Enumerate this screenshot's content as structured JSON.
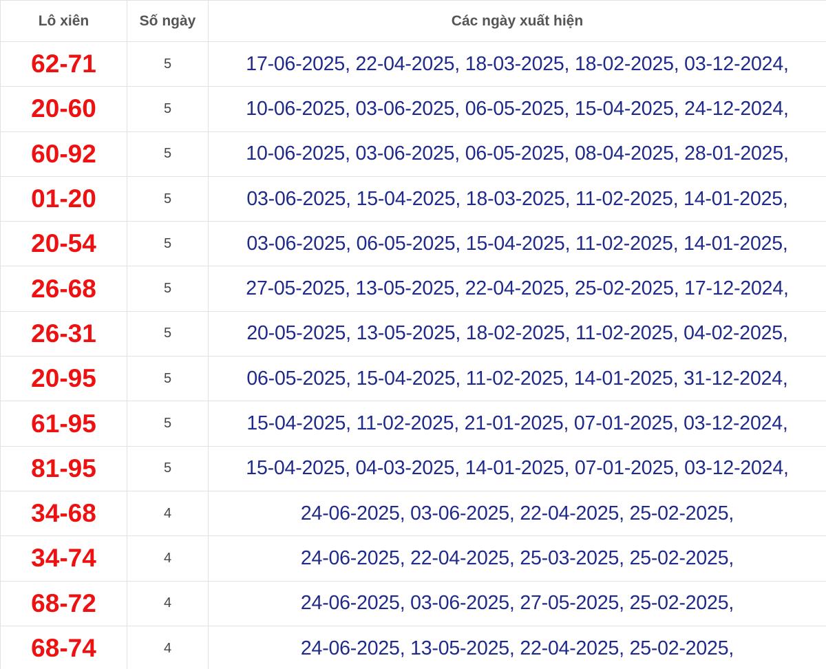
{
  "colors": {
    "pair": "#ee1111",
    "dates": "#1f2a8a",
    "header": "#555555",
    "count": "#444444",
    "border": "#e2e2e2"
  },
  "header": {
    "pair": "Lô xiên",
    "count": "Số ngày",
    "dates": "Các ngày xuất hiện"
  },
  "rows": [
    {
      "pair": "62-71",
      "count": "5",
      "dates": "17-06-2025, 22-04-2025, 18-03-2025, 18-02-2025, 03-12-2024,"
    },
    {
      "pair": "20-60",
      "count": "5",
      "dates": "10-06-2025, 03-06-2025, 06-05-2025, 15-04-2025, 24-12-2024,"
    },
    {
      "pair": "60-92",
      "count": "5",
      "dates": "10-06-2025, 03-06-2025, 06-05-2025, 08-04-2025, 28-01-2025,"
    },
    {
      "pair": "01-20",
      "count": "5",
      "dates": "03-06-2025, 15-04-2025, 18-03-2025, 11-02-2025, 14-01-2025,"
    },
    {
      "pair": "20-54",
      "count": "5",
      "dates": "03-06-2025, 06-05-2025, 15-04-2025, 11-02-2025, 14-01-2025,"
    },
    {
      "pair": "26-68",
      "count": "5",
      "dates": "27-05-2025, 13-05-2025, 22-04-2025, 25-02-2025, 17-12-2024,"
    },
    {
      "pair": "26-31",
      "count": "5",
      "dates": "20-05-2025, 13-05-2025, 18-02-2025, 11-02-2025, 04-02-2025,"
    },
    {
      "pair": "20-95",
      "count": "5",
      "dates": "06-05-2025, 15-04-2025, 11-02-2025, 14-01-2025, 31-12-2024,"
    },
    {
      "pair": "61-95",
      "count": "5",
      "dates": "15-04-2025, 11-02-2025, 21-01-2025, 07-01-2025, 03-12-2024,"
    },
    {
      "pair": "81-95",
      "count": "5",
      "dates": "15-04-2025, 04-03-2025, 14-01-2025, 07-01-2025, 03-12-2024,"
    },
    {
      "pair": "34-68",
      "count": "4",
      "dates": "24-06-2025, 03-06-2025, 22-04-2025, 25-02-2025,"
    },
    {
      "pair": "34-74",
      "count": "4",
      "dates": "24-06-2025, 22-04-2025, 25-03-2025, 25-02-2025,"
    },
    {
      "pair": "68-72",
      "count": "4",
      "dates": "24-06-2025, 03-06-2025, 27-05-2025, 25-02-2025,"
    },
    {
      "pair": "68-74",
      "count": "4",
      "dates": "24-06-2025, 13-05-2025, 22-04-2025, 25-02-2025,"
    }
  ]
}
